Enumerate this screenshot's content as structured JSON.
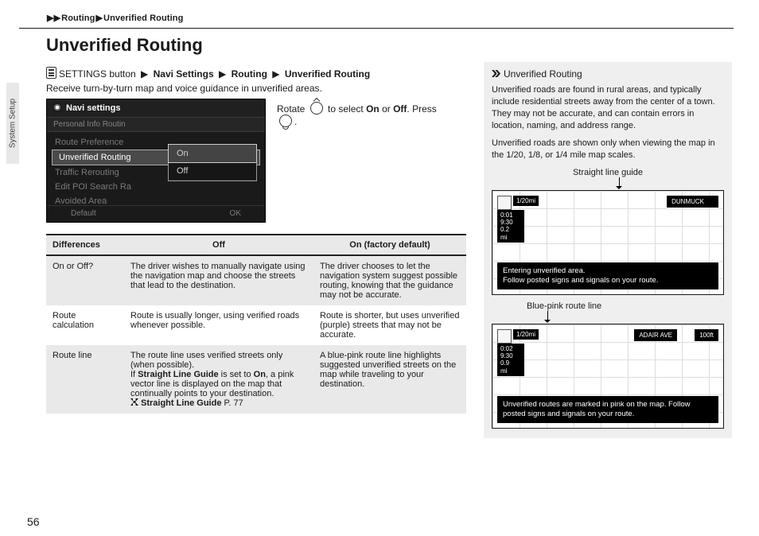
{
  "breadcrumb": {
    "a": "Routing",
    "b": "Unverified Routing"
  },
  "heading": "Unverified Routing",
  "path": {
    "lead": "SETTINGS button",
    "p1": "Navi Settings",
    "p2": "Routing",
    "p3": "Unverified Routing"
  },
  "intro": "Receive turn-by-turn map and voice guidance in unverified areas.",
  "step": {
    "pre": "Rotate ",
    "mid": " to select ",
    "on": "On",
    "or": " or ",
    "off": "Off",
    "post1": ". Press ",
    "post2": "."
  },
  "screenshot": {
    "title": "Navi settings",
    "tabs": "Personal Info        Routin",
    "items": [
      "Route Preference",
      "Unverified Routing",
      "Traffic Rerouting",
      "Edit POI Search Ra",
      "Avoided Area"
    ],
    "popup": {
      "on": "On",
      "off": "Off"
    },
    "footer": {
      "l": "Default",
      "r": "OK"
    }
  },
  "table": {
    "h0": "Differences",
    "h1": "Off",
    "h2": "On (factory default)",
    "r1c0": "On or Off?",
    "r1c1": "The driver wishes to manually navigate using the navigation map and choose the streets that lead to the destination.",
    "r1c2": "The driver chooses to let the navigation system suggest possible routing, knowing that the guidance may not be accurate.",
    "r2c0": "Route calculation",
    "r2c1": "Route is usually longer, using verified roads whenever possible.",
    "r2c2": "Route is shorter, but uses unverified (purple) streets that may not be accurate.",
    "r3c0": "Route line",
    "r3c1a": "The route line uses verified streets only (when possible).",
    "r3c1b_pre": "If ",
    "r3c1b_bold1": "Straight Line Guide",
    "r3c1b_mid": " is set to ",
    "r3c1b_bold2": "On",
    "r3c1b_post": ", a pink vector line is displayed on the map that continually points to your destination.",
    "r3c1_xref": "Straight Line Guide",
    "r3c1_xref_pg": " P. 77",
    "r3c2": "A blue-pink route line highlights suggested unverified streets on the map while traveling to your destination."
  },
  "side": {
    "title": "Unverified Routing",
    "p1": "Unverified roads are found in rural areas, and typically include residential streets away from the center of a town. They may not be accurate, and can contain errors in location, naming, and address range.",
    "p2": "Unverified roads are shown only when viewing the map in the 1/20, 1/8, or 1/4 mile map scales.",
    "label1": "Straight line guide",
    "label2": "Blue-pink route line"
  },
  "map1": {
    "scale": "1/20mi",
    "tl_badge": "0:01\n  9:30\n0.2\nmi",
    "tr": "DUNMUCK",
    "toast": "Entering unverified area.\nFollow posted signs and signals on your route."
  },
  "map2": {
    "scale": "1/20mi",
    "tl_badge": "0:02\n  9:30\n0.9\nmi",
    "tr_a": "ADAIR AVE",
    "tr_b": "100ft",
    "toast": "Unverified routes are marked in pink on the map. Follow posted signs and signals on your route."
  },
  "tab": "System Setup",
  "page_number": "56",
  "chart_data": {
    "type": "table",
    "title": "Unverified Routing — On vs Off behavior",
    "columns": [
      "Differences",
      "Off",
      "On (factory default)"
    ],
    "rows": [
      [
        "On or Off?",
        "The driver wishes to manually navigate using the navigation map and choose the streets that lead to the destination.",
        "The driver chooses to let the navigation system suggest possible routing, knowing that the guidance may not be accurate."
      ],
      [
        "Route calculation",
        "Route is usually longer, using verified roads whenever possible.",
        "Route is shorter, but uses unverified (purple) streets that may not be accurate."
      ],
      [
        "Route line",
        "The route line uses verified streets only (when possible). If Straight Line Guide is set to On, a pink vector line is displayed on the map that continually points to your destination. ➔ Straight Line Guide P. 77",
        "A blue-pink route line highlights suggested unverified streets on the map while traveling to your destination."
      ]
    ]
  }
}
